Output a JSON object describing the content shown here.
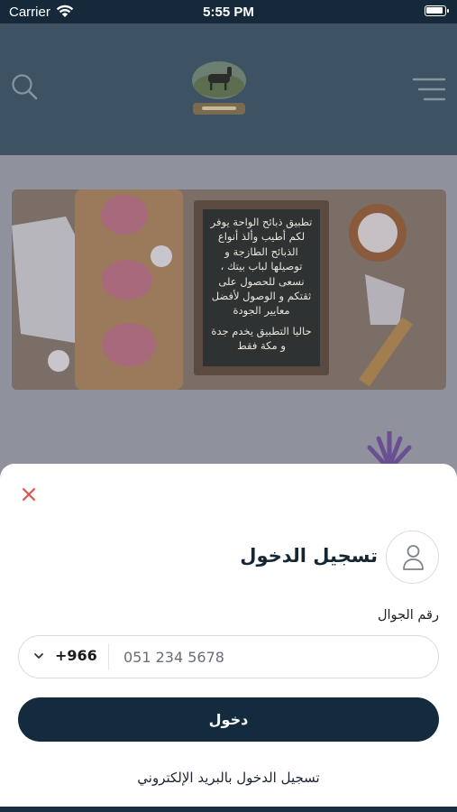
{
  "status_bar": {
    "carrier": "Carrier",
    "time": "5:55 PM"
  },
  "header": {
    "search_icon": "search-icon",
    "menu_icon": "hamburger-menu-icon",
    "logo": "logo-image"
  },
  "banner": {
    "board_text_1": "تطبيق ذبائح الواحة يوفر لكم أطيب وألذ أنواع الذبائح الطازجة و توصيلها لباب بيتك ، نسعى للحصول على ثقتكم و الوصول لأفضل معايير الجودة",
    "board_text_2": "حاليا التطبيق يخدم جدة و مكة فقط"
  },
  "login_sheet": {
    "close_icon": "close-icon",
    "avatar_icon": "user-icon",
    "title": "تسجيل الدخول",
    "phone_label": "رقم الجوال",
    "country_code": "+966",
    "phone_placeholder": "051 234 5678",
    "login_button": "دخول",
    "email_login_link": "تسجيل الدخول بالبريد الإلكتروني"
  },
  "colors": {
    "header_bg": "#3d5363",
    "primary_button": "#132b3d",
    "close_icon": "#e0564f"
  }
}
